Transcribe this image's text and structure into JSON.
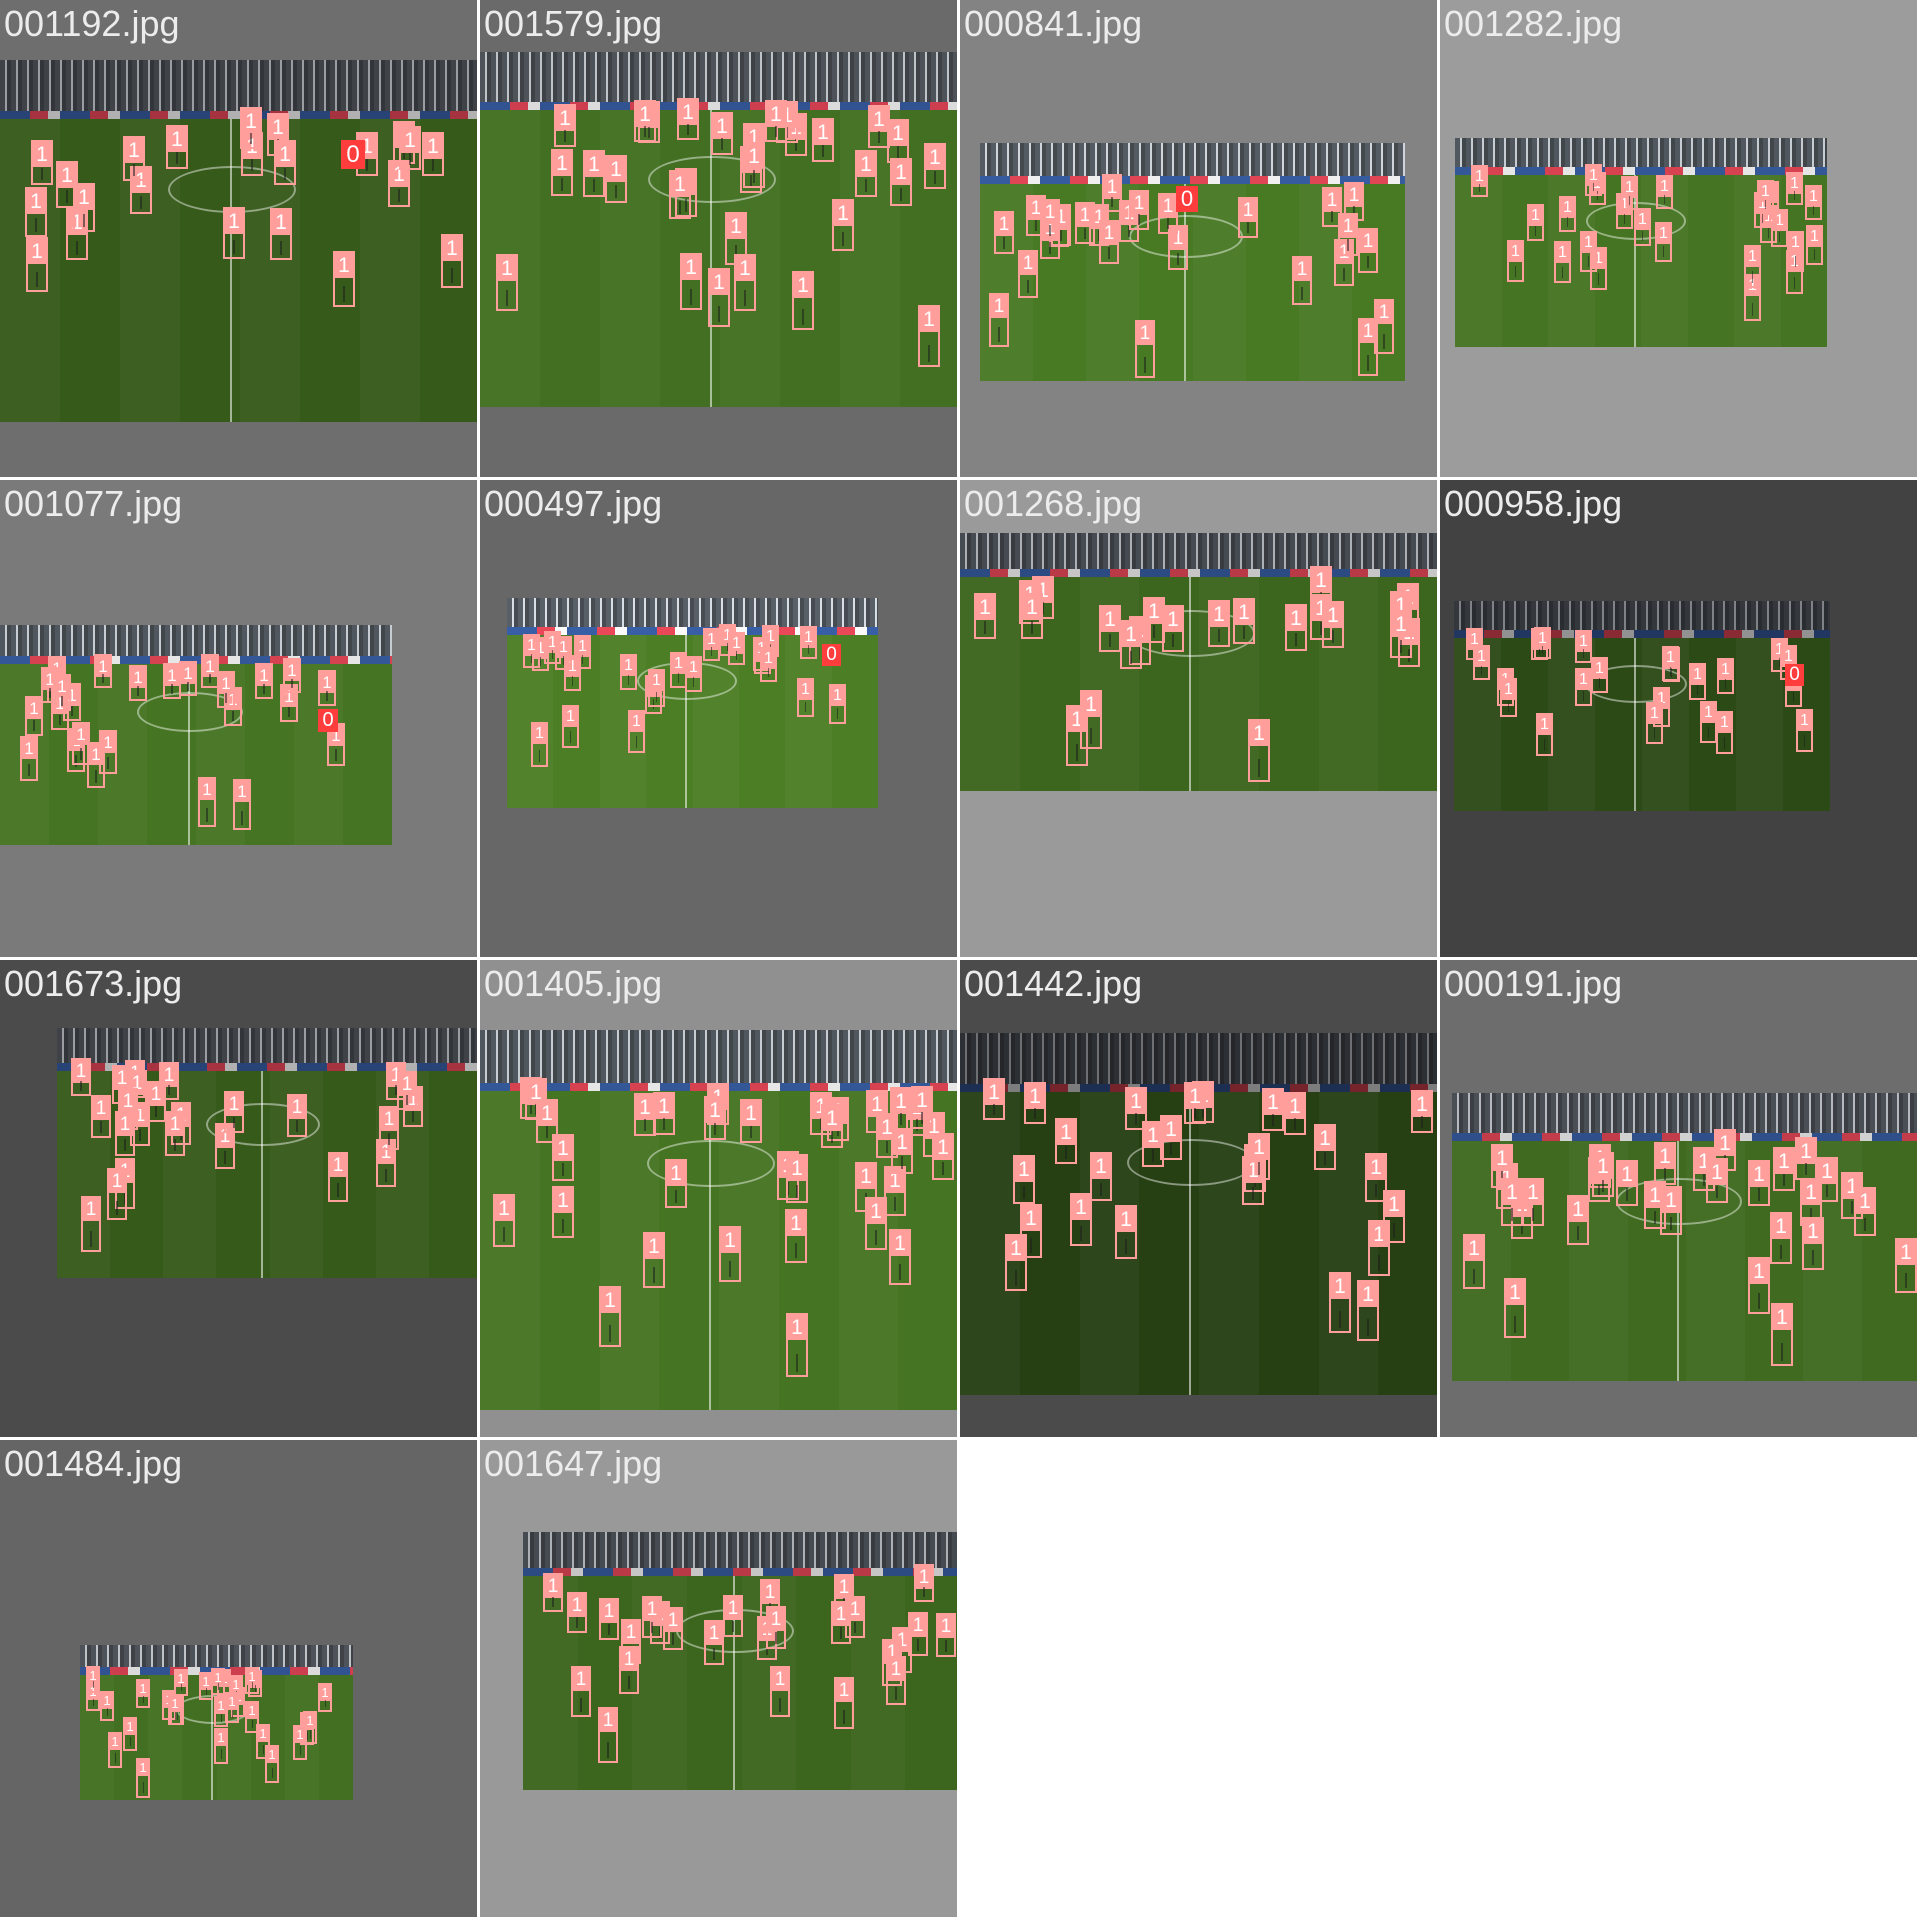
{
  "mosaic": {
    "tiles": [
      {
        "filename": "001192.jpg"
      },
      {
        "filename": "001579.jpg"
      },
      {
        "filename": "000841.jpg"
      },
      {
        "filename": "001282.jpg"
      },
      {
        "filename": "001077.jpg"
      },
      {
        "filename": "000497.jpg"
      },
      {
        "filename": "001268.jpg"
      },
      {
        "filename": "000958.jpg"
      },
      {
        "filename": "001673.jpg"
      },
      {
        "filename": "001405.jpg"
      },
      {
        "filename": "001442.jpg"
      },
      {
        "filename": "000191.jpg"
      },
      {
        "filename": "001484.jpg"
      },
      {
        "filename": "001647.jpg"
      }
    ],
    "class_labels": {
      "player": "1",
      "ball": "0"
    },
    "colors": {
      "player_box": "#ff9e9a",
      "ball_box": "#ff3d3d",
      "label_text": "#ffffff",
      "filename_text": "#ececec",
      "pitch": "#3f6a1f",
      "stands": "#4a4f55"
    }
  }
}
